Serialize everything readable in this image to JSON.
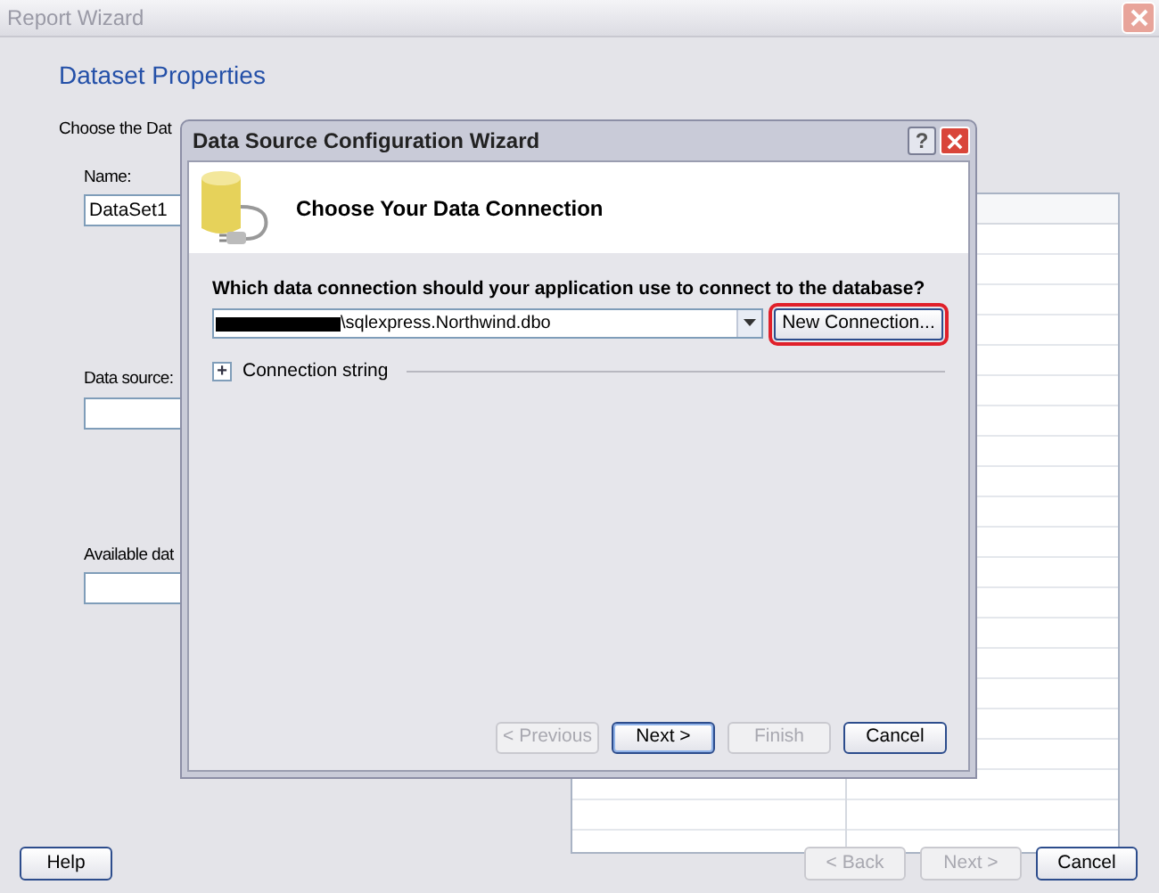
{
  "window": {
    "title": "Report Wizard",
    "active": false
  },
  "page": {
    "heading": "Dataset Properties",
    "intro": "Choose the Dat",
    "fields": [
      {
        "label": "Name:",
        "value": "DataSet1"
      },
      {
        "label": "Data source:"
      },
      {
        "label": "Available dat"
      }
    ]
  },
  "buttons": [
    {
      "label": "Help",
      "disabled": false
    },
    {
      "label": "< Back",
      "disabled": true
    },
    {
      "label": "Next >",
      "disabled": true
    },
    {
      "label": "Cancel",
      "disabled": false
    }
  ],
  "dialog": {
    "title": "Data Source Configuration Wizard",
    "help": "?",
    "heading": "Choose Your Data Connection",
    "question": "Which data connection should your application use to connect to the database?",
    "connection": {
      "value": "\\sqlexpress.Northwind.dbo",
      "redacted": true
    },
    "new_connection": {
      "label": "New Connection...",
      "highlighted": true
    },
    "connection_string": {
      "label": "Connection string",
      "expanded": false,
      "toggle": "+"
    },
    "buttons": [
      {
        "label": "< Previous",
        "disabled": true,
        "default": false
      },
      {
        "label": "Next >",
        "disabled": false,
        "default": true
      },
      {
        "label": "Finish",
        "disabled": true,
        "default": false
      },
      {
        "label": "Cancel",
        "disabled": false,
        "default": false
      }
    ]
  }
}
